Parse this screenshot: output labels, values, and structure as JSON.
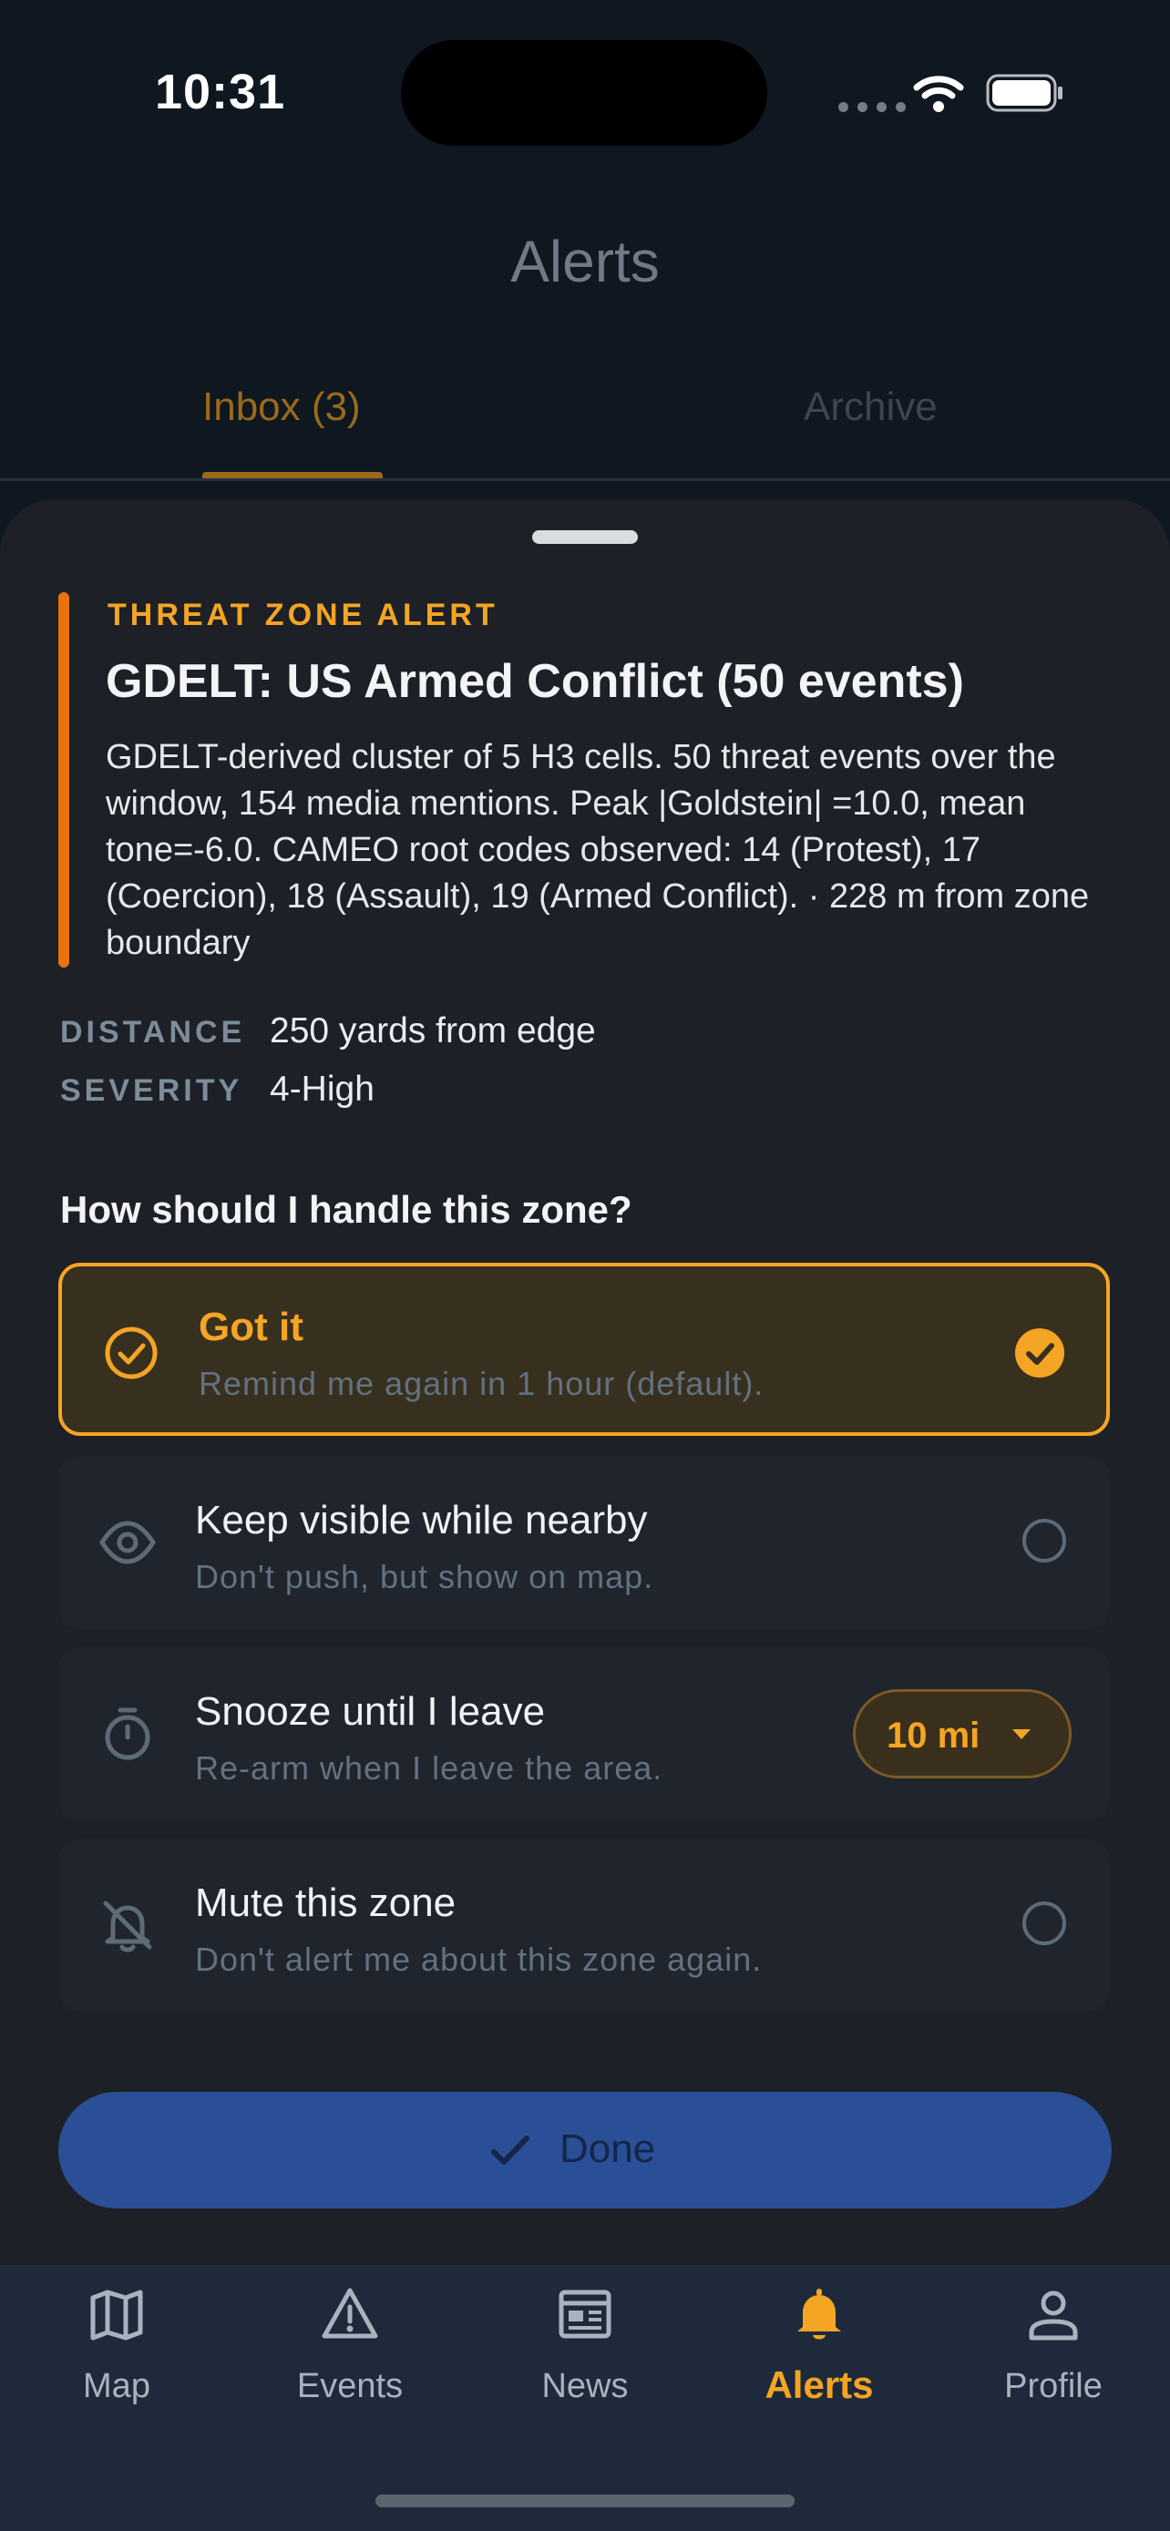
{
  "status_bar": {
    "time": "10:31"
  },
  "header": {
    "title": "Alerts"
  },
  "tabs": [
    {
      "label": "Inbox (3)",
      "active": true
    },
    {
      "label": "Archive",
      "active": false
    }
  ],
  "alert": {
    "kicker": "THREAT ZONE ALERT",
    "title": "GDELT: US Armed Conflict (50 events)",
    "body": "GDELT-derived cluster of 5 H3 cells. 50 threat events over the window, 154 media mentions. Peak |Goldstein| =10.0, mean tone=-6.0. CAMEO root codes observed: 14 (Protest), 17 (Coercion), 18 (Assault), 19 (Armed Conflict). · 228 m from zone boundary",
    "accent_color": "#e8720c",
    "meta": [
      {
        "label": "DISTANCE",
        "value": "250 yards from edge"
      },
      {
        "label": "SEVERITY",
        "value": "4-High"
      }
    ]
  },
  "question": "How should I handle this zone?",
  "options": [
    {
      "title": "Got it",
      "subtitle": "Remind me again in 1 hour (default).",
      "icon": "check-circle-icon",
      "selected": true
    },
    {
      "title": "Keep visible while nearby",
      "subtitle": "Don't push, but show on map.",
      "icon": "eye-icon",
      "selected": false
    },
    {
      "title": "Snooze until I leave",
      "subtitle": "Re-arm when I leave the area.",
      "icon": "timer-icon",
      "selected": false,
      "distance": "10 mi"
    },
    {
      "title": "Mute this zone",
      "subtitle": "Don't alert me about this zone again.",
      "icon": "bell-off-icon",
      "selected": false
    }
  ],
  "done_label": "Done",
  "nav": [
    {
      "label": "Map",
      "icon": "map-icon"
    },
    {
      "label": "Events",
      "icon": "warning-icon"
    },
    {
      "label": "News",
      "icon": "news-icon"
    },
    {
      "label": "Alerts",
      "icon": "bell-icon",
      "active": true
    },
    {
      "label": "Profile",
      "icon": "profile-icon"
    }
  ],
  "colors": {
    "accent": "#f5a524",
    "primary_button": "#2a4f96",
    "nav_background": "#1e2a3b"
  }
}
